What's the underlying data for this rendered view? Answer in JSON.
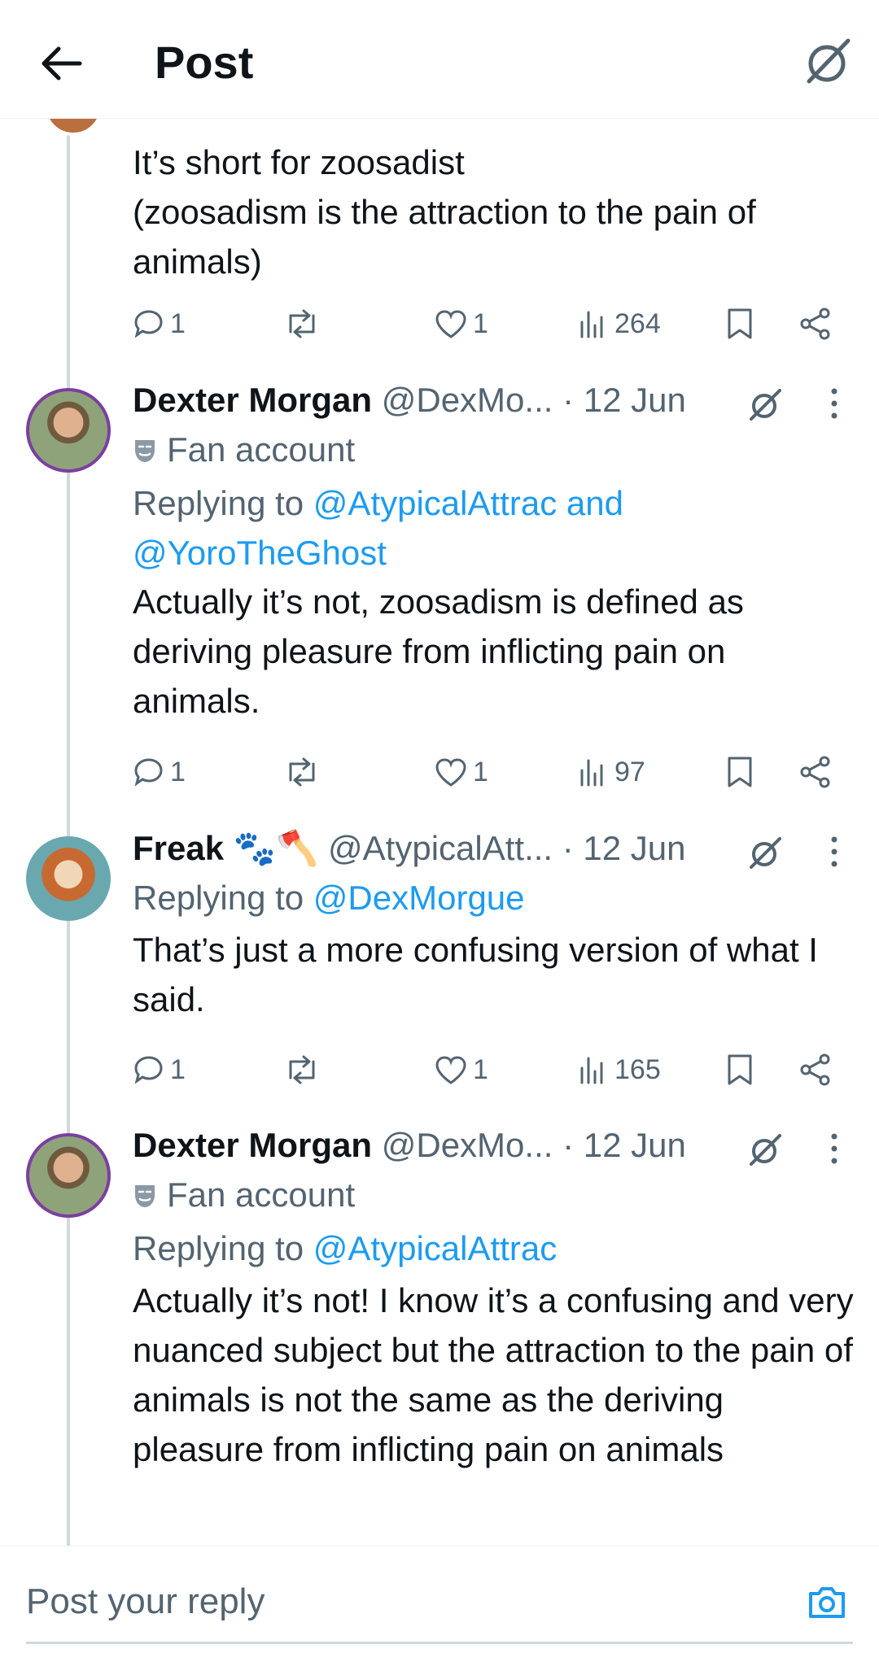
{
  "header": {
    "title": "Post"
  },
  "posts": [
    {
      "body": "It’s short for zoosadist\n(zoosadism is the attraction to the pain of animals)",
      "actions": {
        "replies": "1",
        "likes": "1",
        "views": "264"
      }
    },
    {
      "name": "Dexter Morgan",
      "handle": "@DexMo...",
      "date": "12 Jun",
      "label": "Fan account",
      "reply_prefix": "Replying to ",
      "reply_mentions": "@AtypicalAttrac and @YoroTheGhost",
      "body": "Actually it’s not, zoosadism is defined as deriving pleasure from inflicting pain on animals.",
      "actions": {
        "replies": "1",
        "likes": "1",
        "views": "97"
      }
    },
    {
      "name": "Freak 🐾🪓",
      "handle": "@AtypicalAtt...",
      "date": "12 Jun",
      "reply_prefix": "Replying to ",
      "reply_mentions": "@DexMorgue",
      "body": "That’s just a more confusing version of what I said.",
      "actions": {
        "replies": "1",
        "likes": "1",
        "views": "165"
      }
    },
    {
      "name": "Dexter Morgan",
      "handle": "@DexMo...",
      "date": "12 Jun",
      "label": "Fan account",
      "reply_prefix": "Replying to ",
      "reply_mentions": "@AtypicalAttrac",
      "body": "Actually it’s not! I know it’s a confusing and very nuanced subject but the attraction to the pain of animals is not the same as the deriving pleasure from inflicting pain on animals"
    }
  ],
  "separator": "·",
  "reply_bar": {
    "placeholder": "Post your reply"
  },
  "colors": {
    "accent": "#1d9bf0",
    "secondary_text": "#536471",
    "thread_line": "#cfd9de"
  }
}
